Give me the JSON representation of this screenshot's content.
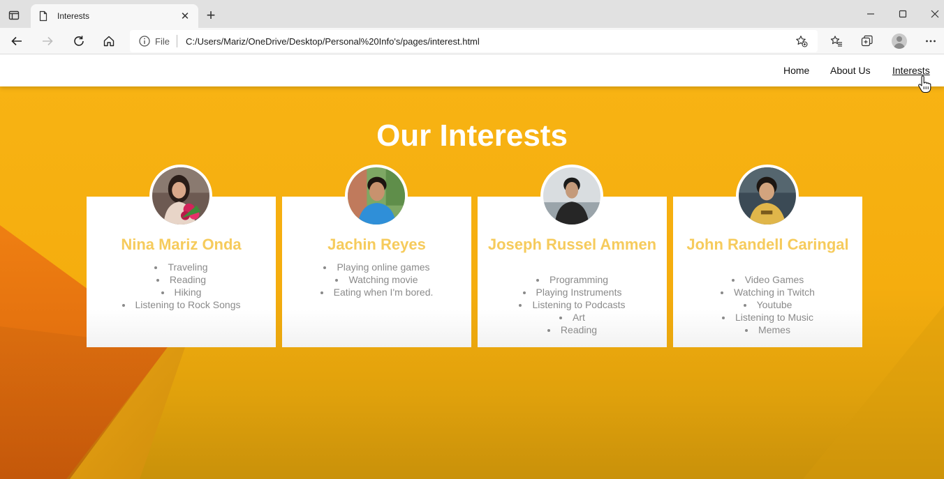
{
  "browser": {
    "tab_title": "Interests",
    "address_file_label": "File",
    "url": "C:/Users/Mariz/OneDrive/Desktop/Personal%20Info's/pages/interest.html"
  },
  "nav": {
    "links": [
      {
        "label": "Home"
      },
      {
        "label": "About Us"
      },
      {
        "label": "Interests",
        "active": true
      }
    ]
  },
  "page": {
    "heading": "Our Interests"
  },
  "members": [
    {
      "name": "Nina Mariz Onda",
      "interests": [
        "Traveling",
        "Reading",
        "Hiking",
        "Listening to Rock Songs"
      ]
    },
    {
      "name": "Jachin Reyes",
      "interests": [
        "Playing online games",
        "Watching movie",
        "Eating when I'm bored."
      ]
    },
    {
      "name": "Joseph Russel Ammen",
      "interests": [
        "Programming",
        "Playing Instruments",
        "Listening to Podcasts",
        "Art",
        "Reading"
      ]
    },
    {
      "name": "John Randell Caringal",
      "interests": [
        "Video Games",
        "Watching in Twitch",
        "Youtube",
        "Listening to Music",
        "Memes"
      ]
    }
  ],
  "colors": {
    "background_yellow": "#f8b414",
    "name_color": "#f6cb5c",
    "interest_text": "#8a8a8a"
  }
}
